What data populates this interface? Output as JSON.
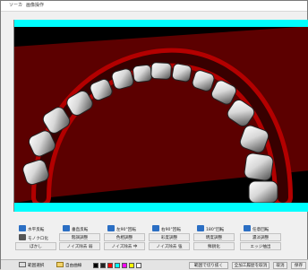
{
  "window": {
    "title_prefix": "ソーカ",
    "title": "画像操作"
  },
  "colors": {
    "background_stripe": "#00ffff",
    "viewport_bg": "#000000",
    "plate": "#5a0000",
    "gum": "#cc1a1a",
    "tooth": "#d9d9d9"
  },
  "toolbar": {
    "row1": [
      {
        "label": "水平反転",
        "icon": "flip-horizontal-icon",
        "color": "#2b6fc4"
      },
      {
        "label": "垂直反転",
        "icon": "flip-vertical-icon",
        "color": "#2b6fc4"
      },
      {
        "label": "左90°回転",
        "icon": "rotate-left-icon",
        "color": "#2b6fc4"
      },
      {
        "label": "右90°回転",
        "icon": "rotate-right-icon",
        "color": "#2b6fc4"
      },
      {
        "label": "180°回転",
        "icon": "rotate-180-icon",
        "color": "#2b6fc4"
      },
      {
        "label": "任意回転",
        "icon": "rotate-free-icon",
        "color": "#2b6fc4"
      }
    ],
    "row2": [
      {
        "label": "モノクロ化",
        "icon": "monochrome-icon",
        "color": "#555555"
      },
      {
        "label": "階調調整",
        "icon": "",
        "color": ""
      },
      {
        "label": "色相調整",
        "icon": "",
        "color": ""
      },
      {
        "label": "彩度調整",
        "icon": "",
        "color": ""
      },
      {
        "label": "明度調整",
        "icon": "",
        "color": ""
      },
      {
        "label": "濃淡調整",
        "icon": "",
        "color": ""
      }
    ],
    "row3": [
      {
        "label": "ぼかし",
        "icon": "",
        "color": ""
      },
      {
        "label": "ノイズ除去 弱",
        "icon": "",
        "color": ""
      },
      {
        "label": "ノイズ除去 中",
        "icon": "",
        "color": ""
      },
      {
        "label": "ノイズ除去 強",
        "icon": "",
        "color": ""
      },
      {
        "label": "鮮鋭化",
        "icon": "",
        "color": ""
      },
      {
        "label": "エッジ抽出",
        "icon": "",
        "color": ""
      }
    ]
  },
  "bottombar": {
    "left_label": "範囲選択",
    "pen_label": "自由曲線",
    "swatches": [
      "#000000",
      "#222222",
      "#ff0000",
      "#00ffff",
      "#ff00ff",
      "#ffff00",
      "#ffffff"
    ],
    "buttons": {
      "crop": "範囲で切り抜く",
      "cancel_all": "全加工履歴を取消",
      "undo": "取消",
      "save": "保存"
    }
  }
}
